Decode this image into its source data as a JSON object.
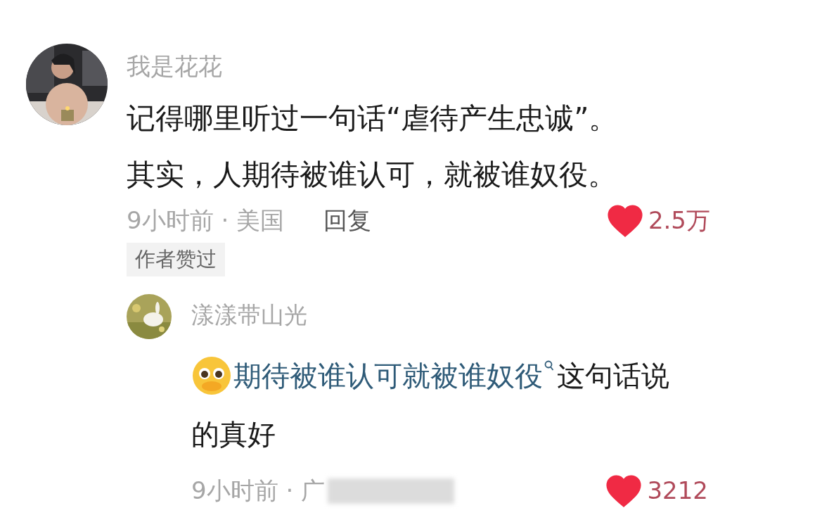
{
  "comment": {
    "user": "我是花花",
    "lines": [
      "记得哪里听过一句话“虐待产生忠诚”。",
      "其实，人期待被谁认可，就被谁奴役。"
    ],
    "meta": "9小时前 · 美国",
    "reply_label": "回复",
    "likes": "2.5万",
    "liked": true,
    "badge": "作者赞过"
  },
  "reply": {
    "user": "漾漾带山光",
    "link": "期待被谁认可就被谁奴役",
    "line1_rest": "这句话说",
    "line2": "的真好",
    "meta": "9小时前 · 广",
    "likes": "3212",
    "liked": true
  }
}
